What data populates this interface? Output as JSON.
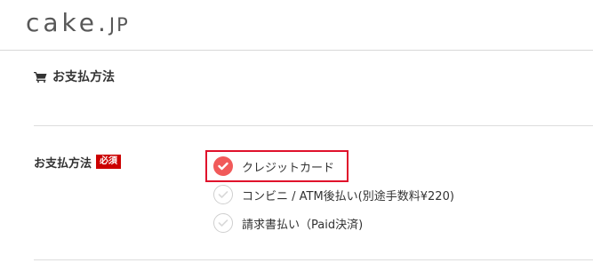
{
  "header": {
    "logo_main": "cake.",
    "logo_suffix": "JP"
  },
  "section": {
    "icon": "shopping-cart-icon",
    "title": "お支払方法"
  },
  "field": {
    "label": "お支払方法",
    "required_badge": "必須"
  },
  "payment_options": [
    {
      "label": "クレジットカード",
      "selected": true
    },
    {
      "label": "コンビニ / ATM後払い(別途手数料¥220)",
      "selected": false
    },
    {
      "label": "請求書払い（Paid決済)",
      "selected": false
    }
  ],
  "colors": {
    "accent": "#f15a5a",
    "required_badge": "#cc0000",
    "highlight_border": "#e0112b",
    "logo": "#585858"
  }
}
